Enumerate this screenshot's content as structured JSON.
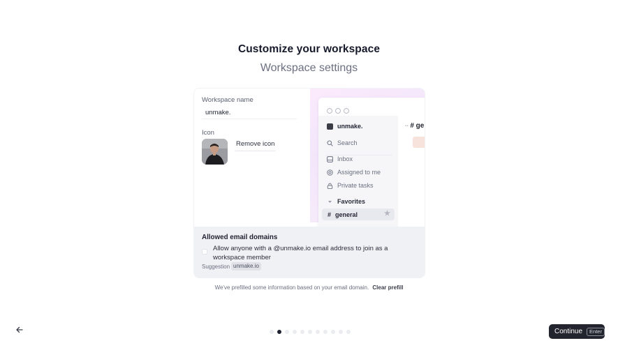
{
  "header": {
    "title": "Customize your workspace",
    "subtitle": "Workspace settings"
  },
  "form": {
    "workspace_name_label": "Workspace name",
    "workspace_name_value": "unmake.",
    "icon_label": "Icon",
    "remove_icon_label": "Remove icon"
  },
  "preview": {
    "workspace_name": "unmake.",
    "search_label": "Search",
    "nav_items": [
      "Inbox",
      "Assigned to me",
      "Private tasks"
    ],
    "favorites_label": "Favorites",
    "channel_label": "general",
    "channel_hash": "#",
    "main_channel_peek": "# ge"
  },
  "email_domains": {
    "title": "Allowed email domains",
    "allow_text": "Allow anyone with a @unmake.io email address to join as a workspace member",
    "checked": false,
    "suggestion_label": "Suggestion",
    "suggestion_chip": "unmake.io"
  },
  "footer_note": {
    "text": "We've prefilled some information based on your email domain.",
    "clear_link": "Clear prefill"
  },
  "pagination": {
    "total": 11,
    "current_index": 1
  },
  "actions": {
    "continue_label": "Continue",
    "continue_shortcut": "Enter"
  },
  "colors": {
    "primary_button": "#22252d",
    "preview_gradient": "#f3e6fb",
    "domains_bg": "#f0f1f5"
  }
}
